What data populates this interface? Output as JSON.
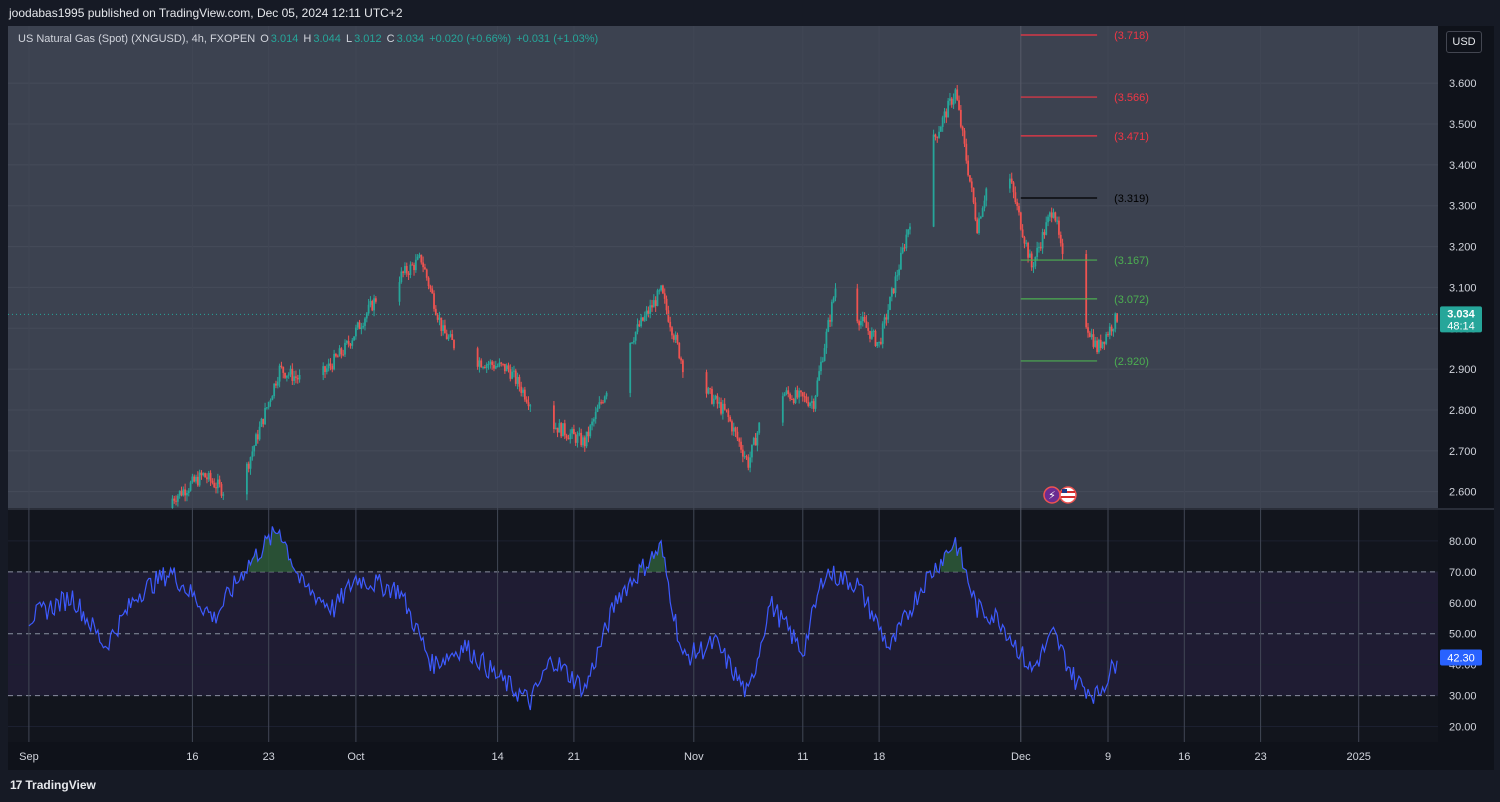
{
  "header": {
    "publisher_text": "joodabas1995 published on TradingView.com, Dec 05, 2024 12:11 UTC+2"
  },
  "legend": {
    "symbol": "US Natural Gas (Spot) (XNGUSD), 4h, FXOPEN",
    "o_label": "O",
    "o_value": "3.014",
    "h_label": "H",
    "h_value": "3.044",
    "l_label": "L",
    "l_value": "3.012",
    "c_label": "C",
    "c_value": "3.034",
    "change": "+0.020 (+0.66%)",
    "change2": "+0.031 (+1.03%)"
  },
  "currency_button": "USD",
  "footer": {
    "brand": "TradingView"
  },
  "colors": {
    "bull": "#26a69a",
    "bear": "#ef5350",
    "rsi": "#3d5afe",
    "level_red": "#f23645",
    "level_green": "#4caf50",
    "level_black": "#000000"
  },
  "chart_data": [
    {
      "type": "candlestick",
      "timeframe": "4h",
      "ylim": [
        2.56,
        3.74
      ],
      "y_ticks": [
        "3.600",
        "3.500",
        "3.400",
        "3.300",
        "3.200",
        "3.100",
        "3.000",
        "2.900",
        "2.800",
        "2.700",
        "2.600"
      ],
      "x_ticks": [
        "Sep",
        "16",
        "23",
        "Oct",
        "14",
        "21",
        "Nov",
        "11",
        "18",
        "Dec",
        "9",
        "16",
        "23",
        "2025"
      ],
      "last_price": "3.034",
      "countdown": "48:14",
      "swing_path": [
        {
          "date": "2024-09-13",
          "close": 2.56
        },
        {
          "date": "2024-09-17",
          "close": 2.64
        },
        {
          "date": "2024-09-20",
          "close": 2.58
        },
        {
          "date": "2024-09-24",
          "close": 2.9
        },
        {
          "date": "2024-09-27",
          "close": 2.86
        },
        {
          "date": "2024-09-30",
          "close": 2.95
        },
        {
          "date": "2024-10-03",
          "close": 3.08
        },
        {
          "date": "2024-10-07",
          "close": 3.17
        },
        {
          "date": "2024-10-09",
          "close": 2.99
        },
        {
          "date": "2024-10-11",
          "close": 2.93
        },
        {
          "date": "2024-10-15",
          "close": 2.9
        },
        {
          "date": "2024-10-18",
          "close": 2.78
        },
        {
          "date": "2024-10-22",
          "close": 2.72
        },
        {
          "date": "2024-10-25",
          "close": 2.92
        },
        {
          "date": "2024-10-29",
          "close": 3.09
        },
        {
          "date": "2024-10-31",
          "close": 2.91
        },
        {
          "date": "2024-11-04",
          "close": 2.79
        },
        {
          "date": "2024-11-06",
          "close": 2.67
        },
        {
          "date": "2024-11-08",
          "close": 2.85
        },
        {
          "date": "2024-11-12",
          "close": 2.82
        },
        {
          "date": "2024-11-14",
          "close": 3.1
        },
        {
          "date": "2024-11-18",
          "close": 2.96
        },
        {
          "date": "2024-11-20",
          "close": 3.17
        },
        {
          "date": "2024-11-22",
          "close": 3.4
        },
        {
          "date": "2024-11-25",
          "close": 3.58
        },
        {
          "date": "2024-11-27",
          "close": 3.25
        },
        {
          "date": "2024-11-29",
          "close": 3.47
        },
        {
          "date": "2024-12-02",
          "close": 3.15
        },
        {
          "date": "2024-12-04",
          "close": 3.3
        },
        {
          "date": "2024-12-05",
          "close": 3.14
        },
        {
          "date": "2024-12-08",
          "close": 2.95
        },
        {
          "date": "2024-12-10",
          "close": 3.034
        }
      ],
      "levels": [
        {
          "value": 3.718,
          "label": "(3.718)",
          "color": "red"
        },
        {
          "value": 3.566,
          "label": "(3.566)",
          "color": "red"
        },
        {
          "value": 3.471,
          "label": "(3.471)",
          "color": "red"
        },
        {
          "value": 3.319,
          "label": "(3.319)",
          "color": "black"
        },
        {
          "value": 3.167,
          "label": "(3.167)",
          "color": "green"
        },
        {
          "value": 3.072,
          "label": "(3.072)",
          "color": "green"
        },
        {
          "value": 2.92,
          "label": "(2.920)",
          "color": "green"
        }
      ]
    },
    {
      "type": "line",
      "ylim": [
        15,
        90
      ],
      "y_ticks": [
        "80.00",
        "70.00",
        "60.00",
        "50.00",
        "40.00",
        "30.00",
        "20.00"
      ],
      "bands": [
        30,
        50,
        70
      ],
      "last_value": "42.30",
      "path": [
        {
          "date": "2024-09-01",
          "value": 55
        },
        {
          "date": "2024-09-05",
          "value": 62
        },
        {
          "date": "2024-09-08",
          "value": 46
        },
        {
          "date": "2024-09-11",
          "value": 63
        },
        {
          "date": "2024-09-14",
          "value": 70
        },
        {
          "date": "2024-09-18",
          "value": 55
        },
        {
          "date": "2024-09-21",
          "value": 72
        },
        {
          "date": "2024-09-24",
          "value": 84
        },
        {
          "date": "2024-09-26",
          "value": 66
        },
        {
          "date": "2024-09-29",
          "value": 58
        },
        {
          "date": "2024-10-01",
          "value": 68
        },
        {
          "date": "2024-10-05",
          "value": 64
        },
        {
          "date": "2024-10-08",
          "value": 40
        },
        {
          "date": "2024-10-11",
          "value": 46
        },
        {
          "date": "2024-10-14",
          "value": 36
        },
        {
          "date": "2024-10-17",
          "value": 28
        },
        {
          "date": "2024-10-19",
          "value": 42
        },
        {
          "date": "2024-10-22",
          "value": 32
        },
        {
          "date": "2024-10-25",
          "value": 62
        },
        {
          "date": "2024-10-29",
          "value": 78
        },
        {
          "date": "2024-10-31",
          "value": 42
        },
        {
          "date": "2024-11-03",
          "value": 47
        },
        {
          "date": "2024-11-06",
          "value": 30
        },
        {
          "date": "2024-11-08",
          "value": 60
        },
        {
          "date": "2024-11-11",
          "value": 44
        },
        {
          "date": "2024-11-13",
          "value": 70
        },
        {
          "date": "2024-11-16",
          "value": 66
        },
        {
          "date": "2024-11-19",
          "value": 45
        },
        {
          "date": "2024-11-22",
          "value": 66
        },
        {
          "date": "2024-11-25",
          "value": 80
        },
        {
          "date": "2024-11-27",
          "value": 58
        },
        {
          "date": "2024-11-29",
          "value": 55
        },
        {
          "date": "2024-12-02",
          "value": 38
        },
        {
          "date": "2024-12-04",
          "value": 50
        },
        {
          "date": "2024-12-06",
          "value": 35
        },
        {
          "date": "2024-12-08",
          "value": 30
        },
        {
          "date": "2024-12-10",
          "value": 42.3
        }
      ]
    }
  ]
}
